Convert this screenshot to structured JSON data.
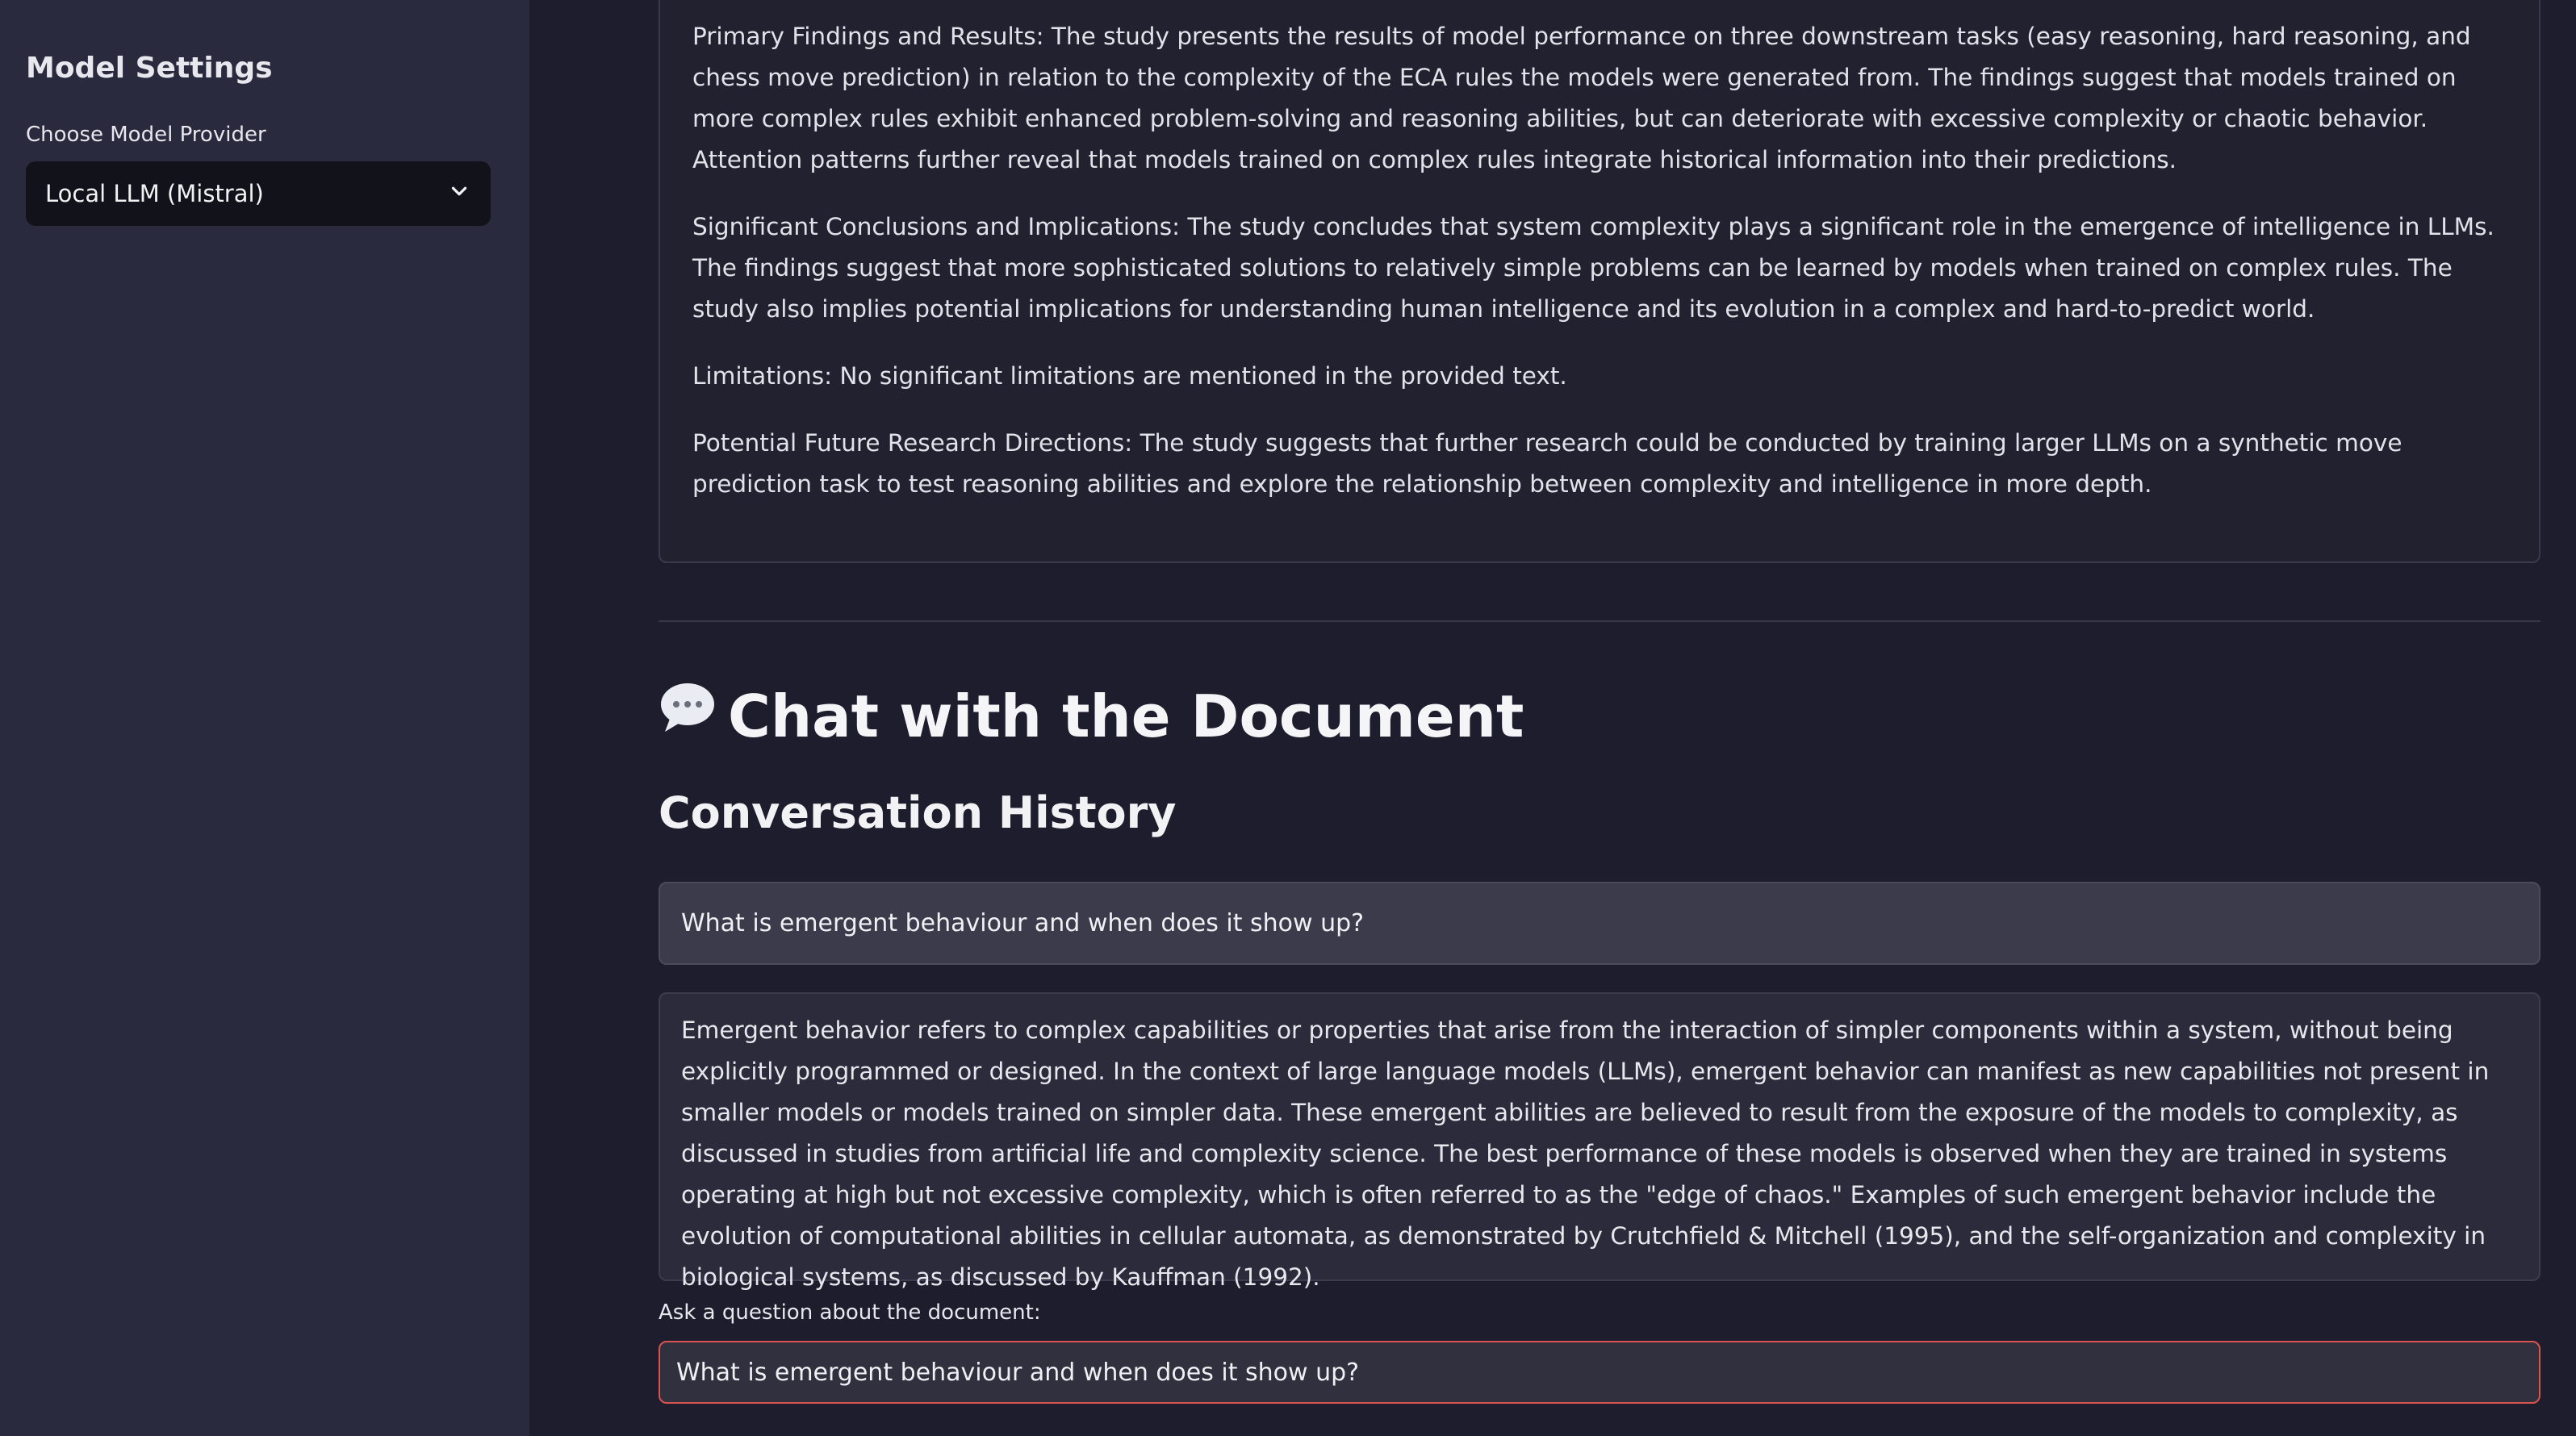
{
  "sidebar": {
    "title": "Model Settings",
    "provider_label": "Choose Model Provider",
    "provider_selected": "Local LLM (Mistral)",
    "chevron_icon": "chevron-down-icon"
  },
  "summary": {
    "paragraphs": [
      "Primary Findings and Results: The study presents the results of model performance on three downstream tasks (easy reasoning, hard reasoning, and chess move prediction) in relation to the complexity of the ECA rules the models were generated from. The findings suggest that models trained on more complex rules exhibit enhanced problem-solving and reasoning abilities, but can deteriorate with excessive complexity or chaotic behavior. Attention patterns further reveal that models trained on complex rules integrate historical information into their predictions.",
      "Significant Conclusions and Implications: The study concludes that system complexity plays a significant role in the emergence of intelligence in LLMs. The findings suggest that more sophisticated solutions to relatively simple problems can be learned by models when trained on complex rules. The study also implies potential implications for understanding human intelligence and its evolution in a complex and hard-to-predict world.",
      "Limitations: No significant limitations are mentioned in the provided text.",
      "Potential Future Research Directions: The study suggests that further research could be conducted by training larger LLMs on a synthetic move prediction task to test reasoning abilities and explore the relationship between complexity and intelligence in more depth."
    ]
  },
  "chat": {
    "header": "Chat with the Document",
    "header_icon": "speech-bubble-icon",
    "history_title": "Conversation History",
    "messages": [
      {
        "role": "user",
        "text": "What is emergent behaviour and when does it show up?"
      },
      {
        "role": "assistant",
        "text": "Emergent behavior refers to complex capabilities or properties that arise from the interaction of simpler components within a system, without being explicitly programmed or designed. In the context of large language models (LLMs), emergent behavior can manifest as new capabilities not present in smaller models or models trained on simpler data. These emergent abilities are believed to result from the exposure of the models to complexity, as discussed in studies from artificial life and complexity science. The best performance of these models is observed when they are trained in systems operating at high but not excessive complexity, which is often referred to as the \"edge of chaos.\" Examples of such emergent behavior include the evolution of computational abilities in cellular automata, as demonstrated by Crutchfield & Mitchell (1995), and the self-organization and complexity in biological systems, as discussed by Kauffman (1992)."
      }
    ],
    "ask_label": "Ask a question about the document:",
    "input_value": "What is emergent behaviour and when does it show up?",
    "input_border_color": "#d9534f"
  }
}
